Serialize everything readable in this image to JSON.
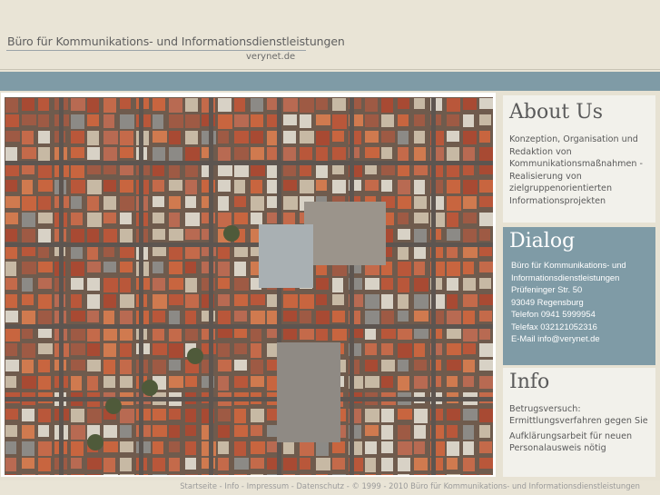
{
  "header": {
    "title": "Büro für Kommunikations- und Informationsdienstleistungen",
    "domain": "verynet.de"
  },
  "photo": {
    "description_icon": "city-aerial-photo"
  },
  "about": {
    "heading": "About Us",
    "lines": [
      "Konzeption, Organisation und",
      "Redaktion von",
      "Kommunikationsmaßnahmen -",
      "Realisierung von",
      "zielgruppenorientierten",
      "Informationsprojekten"
    ]
  },
  "dialog": {
    "heading": "Dialog",
    "lines": [
      "Büro für Kommunikations- und",
      "Informationsdienstleistungen",
      "Prüfeninger Str. 50",
      "93049 Regensburg",
      "Telefon 0941 5999954",
      "Telefax 032121052316",
      "E-Mail info@verynet.de"
    ]
  },
  "info": {
    "heading": "Info",
    "items": [
      {
        "lines": [
          "Betrugsversuch:",
          "Ermittlungsverfahren gegen Sie"
        ]
      },
      {
        "lines": [
          "Aufklärungsarbeit für neuen",
          "Personalausweis nötig"
        ]
      }
    ]
  },
  "footer": {
    "links": [
      "Startseite",
      "Info",
      "Impressum",
      "Datenschutz"
    ],
    "separator": " - ",
    "copyright": "© 1999 - 2010 Büro für Kommunikations- und Informationsdienstleistungen"
  },
  "colors": {
    "background": "#e7e2d3",
    "bar": "#7f9ba6",
    "panel": "#f2f1eb",
    "text": "#5a5a5a"
  }
}
